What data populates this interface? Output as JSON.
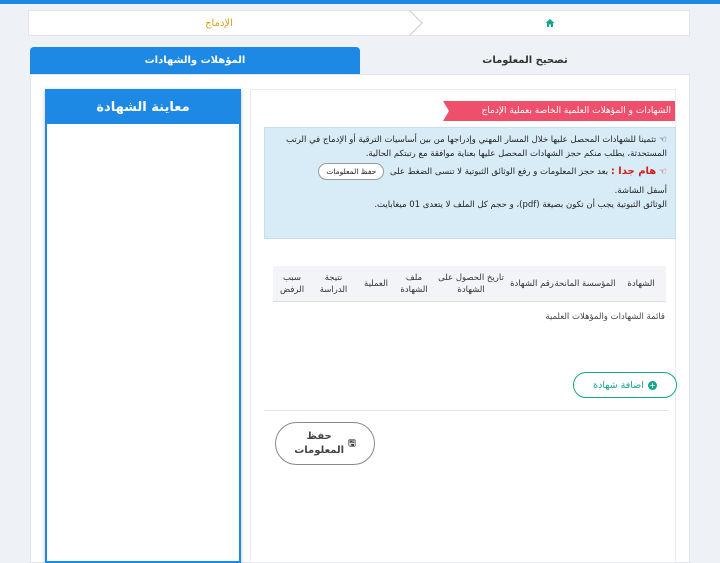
{
  "breadcrumb": {
    "home_icon": "home-icon",
    "current": "الإدماج"
  },
  "tabs": [
    {
      "label": "المؤهلات والشهادات",
      "active": true
    },
    {
      "label": "تصحيح المعلومات",
      "active": false
    }
  ],
  "preview": {
    "title": "معاينة الشهادة"
  },
  "ribbon": "الشهادات و المؤهلات العلمية الخاصة بعملية الإدماج",
  "info": {
    "line1": "تثمينا للشهادات المحصل عليها خلال المسار المهني وإدراجها من بين أساسيات الترقية أو الإدماج في الرتب المستحدثة، يطلب منكم حجز الشهادات المحصل عليها بعناية موافقة مع رتبتكم الحالية.",
    "warn_label": "هام جدا :",
    "warn_text": "بعد حجز المعلومات و رفع الوثائق الثبوتية لا تنسى الضغط على",
    "save_pill": "حفظ المعلومات",
    "warn_text2": "أسفل الشاشة.",
    "line3": "الوثائق الثبوتية يجب أن تكون بصيغة (pdf)، و حجم كل الملف لا يتعدى 01 ميغابايت."
  },
  "table": {
    "headers": [
      "الشهادة",
      "المؤسسة المانحة",
      "رقم الشهادة",
      "تاريخ الحصول على الشهادة",
      "ملف الشهادة",
      "العملية",
      "نتيجة الدراسة",
      "سبب الرفض"
    ]
  },
  "list_label": "قائمة الشهادات والمؤهلات العلمية",
  "add_button": "اضافة شهادة",
  "save_button": "حفظ المعلومات",
  "colors": {
    "accent": "#1e88e5",
    "ribbon": "#ef4f6b",
    "success": "#17a589",
    "info_bg": "#d8ecf7"
  }
}
